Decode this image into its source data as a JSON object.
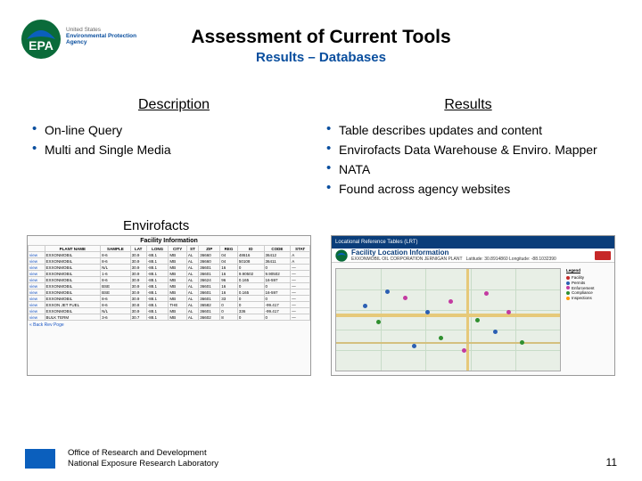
{
  "logo": {
    "abbr": "EPA",
    "line1": "United States",
    "line2": "Environmental Protection",
    "line3": "Agency"
  },
  "title": "Assessment of Current Tools",
  "subtitle": "Results – Databases",
  "columns": {
    "left": {
      "heading": "Description",
      "items": [
        "On-line Query",
        "Multi and Single Media"
      ]
    },
    "right": {
      "heading": "Results",
      "items": [
        "Table describes updates and content",
        "Envirofacts Data Warehouse & Enviro. Mapper",
        "NATA",
        "Found across agency websites"
      ]
    }
  },
  "envirofacts_label": "Envirofacts",
  "thumb_table": {
    "title": "Facility Information",
    "footer_link": "« Back Rev Poge"
  },
  "thumb_map": {
    "header": "Locational Reference Tables (LRT)",
    "title": "Facility Location Information",
    "subtitle": "EXXONMOBIL OIL CORPORATION JERNIGAN PLANT",
    "coords": "Latitude: 30.8914860   Longitude: -88.1032390",
    "legend_title": "Legend",
    "legend_items": [
      "Facility",
      "Permits",
      "Enforcement",
      "Compliance",
      "Inspections"
    ]
  },
  "footer": {
    "line1": "Office of Research and Development",
    "line2": "National Exposure Research Laboratory"
  },
  "page_number": "11"
}
